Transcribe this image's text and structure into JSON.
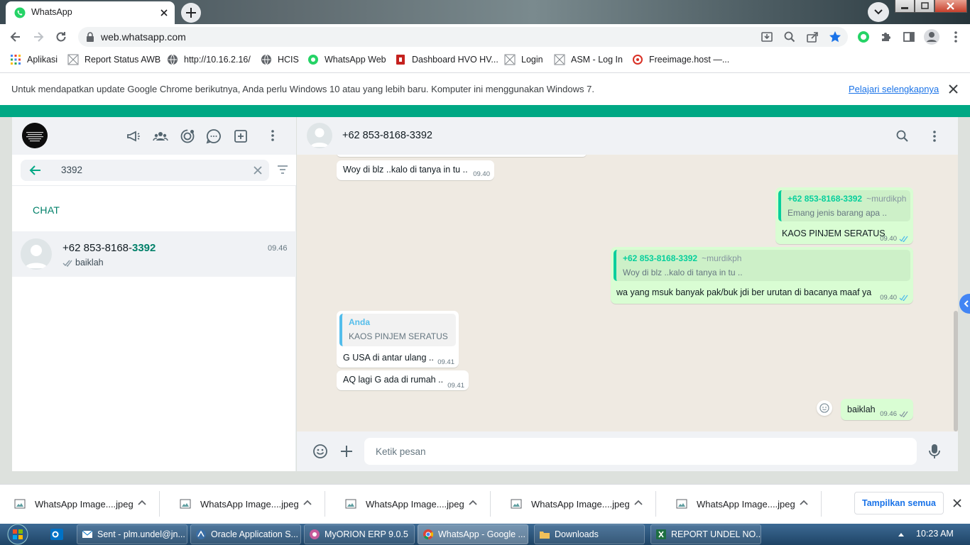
{
  "browser": {
    "tab_title": "WhatsApp",
    "url": "web.whatsapp.com",
    "bookmarks": [
      {
        "label": "Aplikasi",
        "icon": "apps-grid-icon"
      },
      {
        "label": "Report Status AWB",
        "icon": "page-icon"
      },
      {
        "label": "http://10.16.2.16/",
        "icon": "globe-icon"
      },
      {
        "label": "HCIS",
        "icon": "globe-icon"
      },
      {
        "label": "WhatsApp Web",
        "icon": "whatsapp-icon"
      },
      {
        "label": "Dashboard HVO HV...",
        "icon": "dashboard-icon"
      },
      {
        "label": "Login",
        "icon": "page-icon"
      },
      {
        "label": "ASM - Log In",
        "icon": "page-icon"
      },
      {
        "label": "Freeimage.host —...",
        "icon": "freeimage-icon"
      }
    ],
    "infobar": {
      "message": "Untuk mendapatkan update Google Chrome berikutnya, Anda perlu Windows 10 atau yang lebih baru. Komputer ini menggunakan Windows 7.",
      "link": "Pelajari selengkapnya"
    }
  },
  "whatsapp": {
    "search": {
      "value": "3392"
    },
    "section_label": "CHAT",
    "chat_item": {
      "name_prefix": "+62 853-8168-",
      "name_match": "3392",
      "time": "09.46",
      "last_message": "baiklah"
    },
    "conversation": {
      "title": "+62 853-8168-3392",
      "messages": [
        {
          "dir": "in",
          "text": "Woy di blz ..kalo di tanya in tu ..",
          "time": "09.40"
        },
        {
          "dir": "out",
          "quote_author": "+62 853-8168-3392",
          "quote_alias": "~murdikph",
          "quote_text": "Emang jenis barang apa ..",
          "text": "KAOS PINJEM SERATUS",
          "time": "09.40"
        },
        {
          "dir": "out",
          "quote_author": "+62 853-8168-3392",
          "quote_alias": "~murdikph",
          "quote_text": "Woy di blz ..kalo di tanya in tu ..",
          "text": "wa yang msuk banyak pak/buk jdi ber urutan di bacanya maaf ya",
          "time": "09.40"
        },
        {
          "dir": "in",
          "quote_author": "Anda",
          "quote_text": "KAOS PINJEM SERATUS",
          "text": "G USA di antar ulang ..",
          "time": "09.41"
        },
        {
          "dir": "in",
          "text": "AQ lagi G ada di rumah ..",
          "time": "09.41"
        },
        {
          "dir": "out",
          "text": "baiklah",
          "time": "09.46"
        }
      ]
    },
    "composer": {
      "placeholder": "Ketik pesan"
    }
  },
  "downloads": {
    "items": [
      "WhatsApp Image....jpeg",
      "WhatsApp Image....jpeg",
      "WhatsApp Image....jpeg",
      "WhatsApp Image....jpeg",
      "WhatsApp Image....jpeg"
    ],
    "show_all": "Tampilkan semua"
  },
  "taskbar": {
    "items": [
      "Sent - plm.undel@jn...",
      "Oracle Application S...",
      "MyORION ERP 9.0.5",
      "WhatsApp - Google ...",
      "Downloads",
      "REPORT UNDEL NO..."
    ],
    "clock": "10:23 AM"
  },
  "colors": {
    "accent": "#00a884",
    "outgoing_bubble": "#d9fdd3",
    "chat_bg": "#efeae2",
    "link": "#1a73e8"
  }
}
